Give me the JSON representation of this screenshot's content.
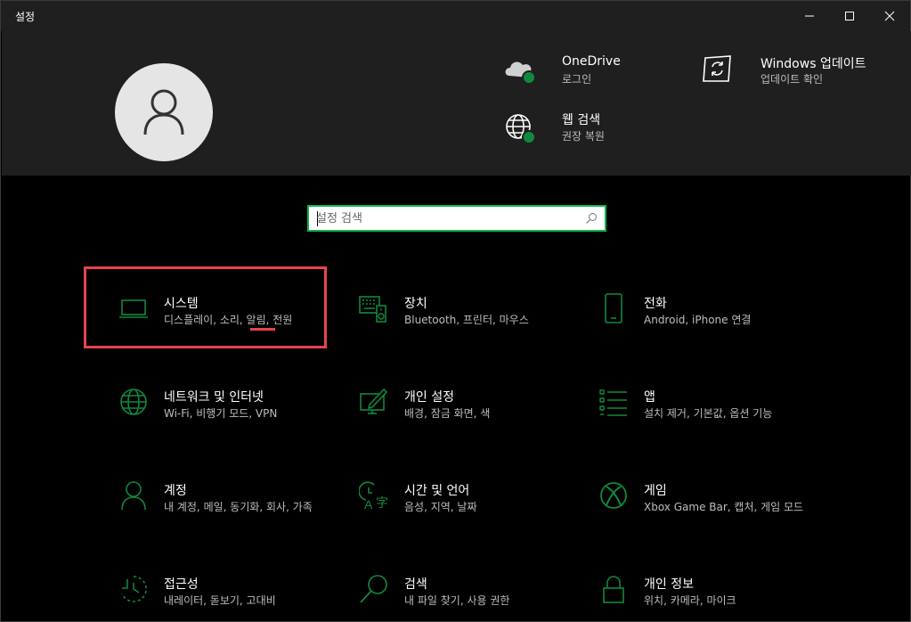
{
  "window": {
    "title": "설정"
  },
  "header": {
    "quick_items": [
      {
        "title": "OneDrive",
        "subtitle": "로그인",
        "icon": "cloud-icon"
      },
      {
        "title": "Windows 업데이트",
        "subtitle": "업데이트 확인",
        "icon": "sync-icon"
      },
      {
        "title": "웹 검색",
        "subtitle": "권장 복원",
        "icon": "globe-icon"
      }
    ]
  },
  "search": {
    "placeholder": "설정 검색"
  },
  "tiles": [
    {
      "title": "시스템",
      "subtitle": "디스플레이, 소리, 알림, 전원",
      "icon": "laptop-icon"
    },
    {
      "title": "장치",
      "subtitle": "Bluetooth, 프린터, 마우스",
      "icon": "keyboard-speaker-icon"
    },
    {
      "title": "전화",
      "subtitle": "Android, iPhone 연결",
      "icon": "phone-icon"
    },
    {
      "title": "네트워크 및 인터넷",
      "subtitle": "Wi-Fi, 비행기 모드, VPN",
      "icon": "globe-icon"
    },
    {
      "title": "개인 설정",
      "subtitle": "배경, 잠금 화면, 색",
      "icon": "personalize-icon"
    },
    {
      "title": "앱",
      "subtitle": "설치 제거, 기본값, 옵션 기능",
      "icon": "apps-list-icon"
    },
    {
      "title": "계정",
      "subtitle": "내 계정, 메일, 동기화, 회사, 가족",
      "icon": "person-icon"
    },
    {
      "title": "시간 및 언어",
      "subtitle": "음성, 지역, 날짜",
      "icon": "time-language-icon"
    },
    {
      "title": "게임",
      "subtitle": "Xbox Game Bar, 캡처, 게임 모드",
      "icon": "xbox-icon"
    },
    {
      "title": "접근성",
      "subtitle": "내레이터, 돋보기, 고대비",
      "icon": "accessibility-icon"
    },
    {
      "title": "검색",
      "subtitle": "내 파일 찾기, 사용 권한",
      "icon": "search-icon"
    },
    {
      "title": "개인 정보",
      "subtitle": "위치, 카메라, 마이크",
      "icon": "lock-icon"
    }
  ],
  "colors": {
    "accent": "#10893e",
    "highlight": "#e8444c",
    "header_bg": "#1f1f1f"
  }
}
